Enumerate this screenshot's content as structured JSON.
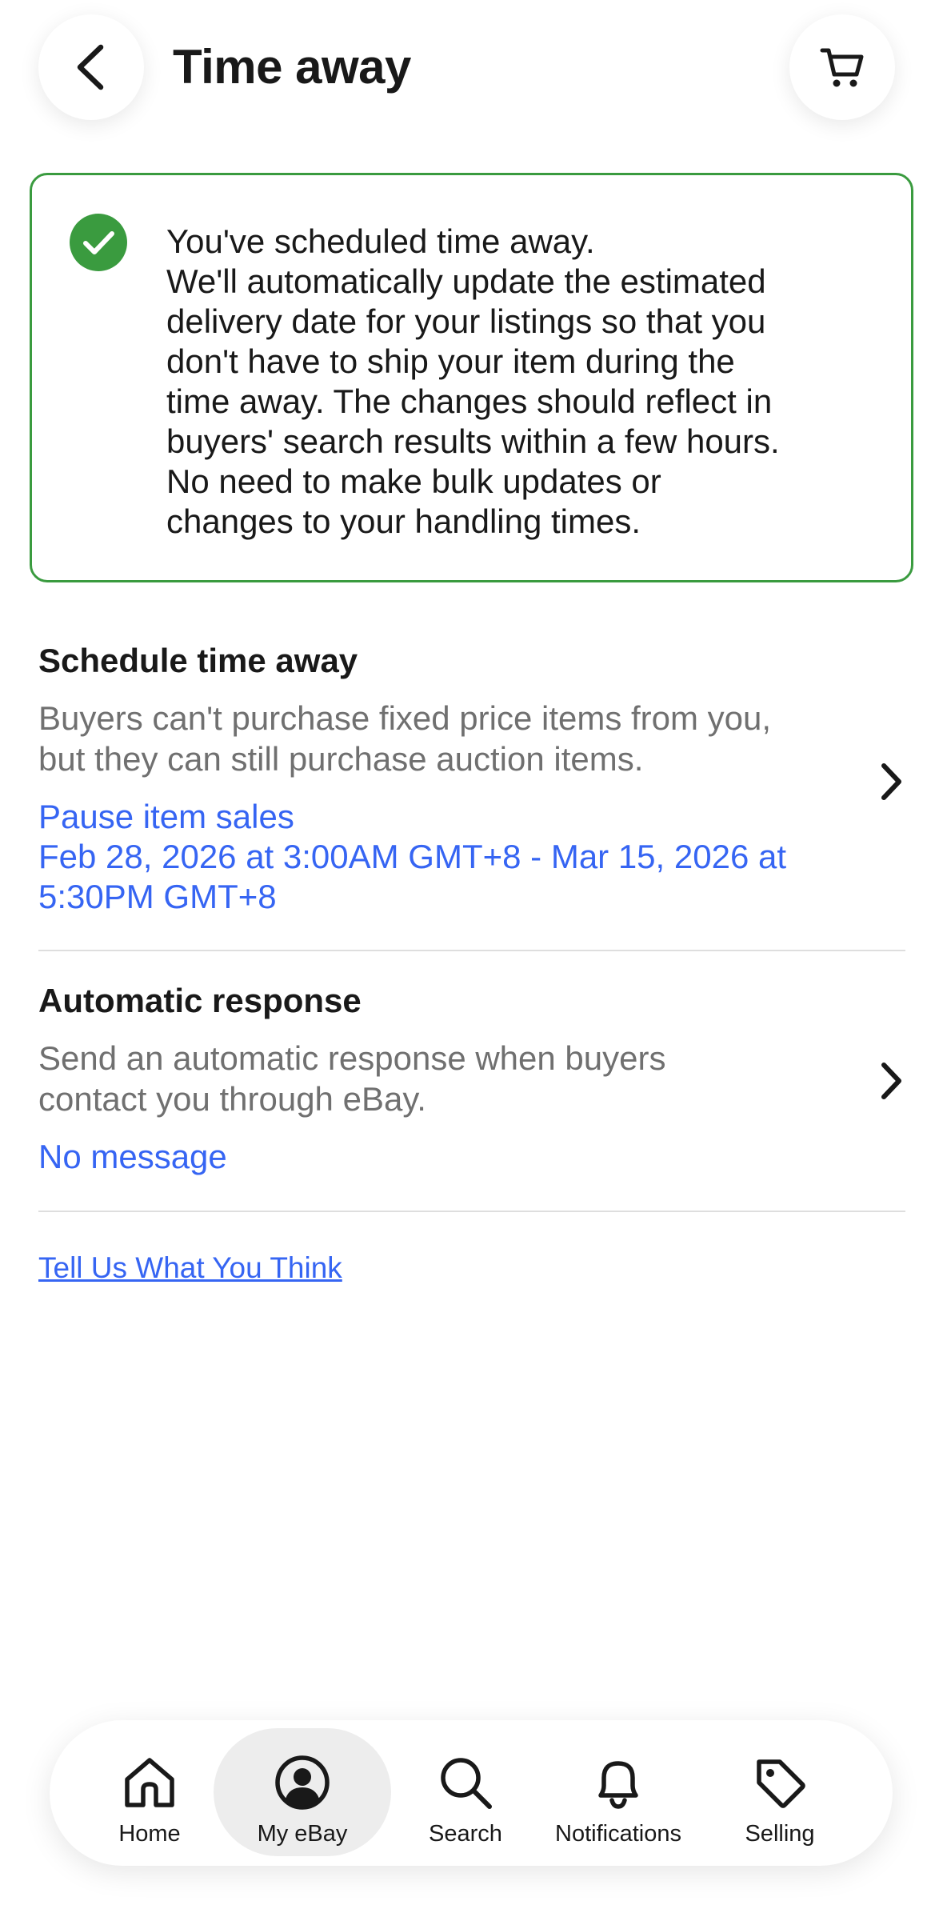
{
  "header": {
    "title": "Time away",
    "back_icon": "chevron-left-icon",
    "cart_icon": "cart-icon"
  },
  "alert": {
    "icon": "check-circle-icon",
    "color": "#3a9b3f",
    "lines": [
      "You've scheduled time away.",
      "We'll automatically update the estimated",
      "delivery date for your listings so that you",
      "don't have to ship your item during the",
      "time away. The changes should reflect in",
      "buyers' search results within a few hours.",
      "No need to make bulk updates or",
      "changes to your handling times."
    ]
  },
  "schedule": {
    "title": "Schedule time away",
    "description_lines": [
      "Buyers can't purchase fixed price items from you,",
      "but they can still purchase auction items."
    ],
    "value_lines": [
      "Pause item sales",
      "Feb 28, 2026 at 3:00AM GMT+8 - Mar 15, 2026 at",
      "5:30PM GMT+8"
    ]
  },
  "auto_response": {
    "title": "Automatic response",
    "description_lines": [
      "Send an automatic response when buyers",
      "contact you through eBay."
    ],
    "value": "No message"
  },
  "feedback_link": "Tell Us What You Think",
  "nav": {
    "items": [
      {
        "label": "Home",
        "icon": "home-icon"
      },
      {
        "label": "My eBay",
        "icon": "user-circle-icon",
        "active": true
      },
      {
        "label": "Search",
        "icon": "search-icon"
      },
      {
        "label": "Notifications",
        "icon": "bell-icon"
      },
      {
        "label": "Selling",
        "icon": "tag-icon"
      }
    ]
  },
  "colors": {
    "link": "#3665f3",
    "success": "#3a9b3f",
    "muted_text": "#707070",
    "active_nav_bg": "#ededed"
  }
}
